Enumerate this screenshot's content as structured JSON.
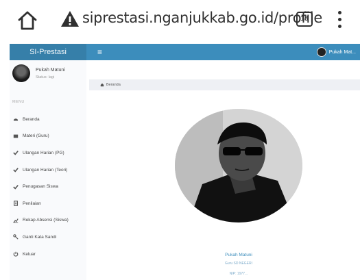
{
  "browser": {
    "url": "siprestasi.nganjukkab.go.id/profile",
    "tab_count": "18",
    "icons": [
      "home-icon",
      "warning-icon",
      "tabs-icon",
      "menu-kebab-icon"
    ]
  },
  "header": {
    "brand": "SI-Prestasi",
    "menu_toggle": "≡",
    "user_name": "Pukah Mat..."
  },
  "sidebar": {
    "user": {
      "name": "Pukah Matuni",
      "status": "Status: lagi"
    },
    "menu_header": "MENU",
    "items": [
      {
        "label": "Beranda",
        "icon": "dashboard-icon"
      },
      {
        "label": "Materi (Guru)",
        "icon": "book-icon"
      },
      {
        "label": "Ulangan Harian (PG)",
        "icon": "check-icon"
      },
      {
        "label": "Ulangan Harian (Teori)",
        "icon": "check-icon"
      },
      {
        "label": "Penugasan Siswa",
        "icon": "check-icon"
      },
      {
        "label": "Penilaian",
        "icon": "document-icon"
      },
      {
        "label": "Rekap Absensi (Siswa)",
        "icon": "chart-line-icon"
      },
      {
        "label": "Ganti Kata Sandi",
        "icon": "key-icon"
      },
      {
        "label": "Keluar",
        "icon": "power-icon"
      }
    ]
  },
  "breadcrumb": {
    "label": "Beranda"
  },
  "profile": {
    "name": "Pukah Matuni",
    "subtitle": "Guru SD NEGERI",
    "nip": "NIP: 1977..."
  },
  "colors": {
    "header": "#3c8dbc",
    "brand": "#367fa9",
    "sidebar": "#f9fafc",
    "link": "#3c8dbc"
  }
}
